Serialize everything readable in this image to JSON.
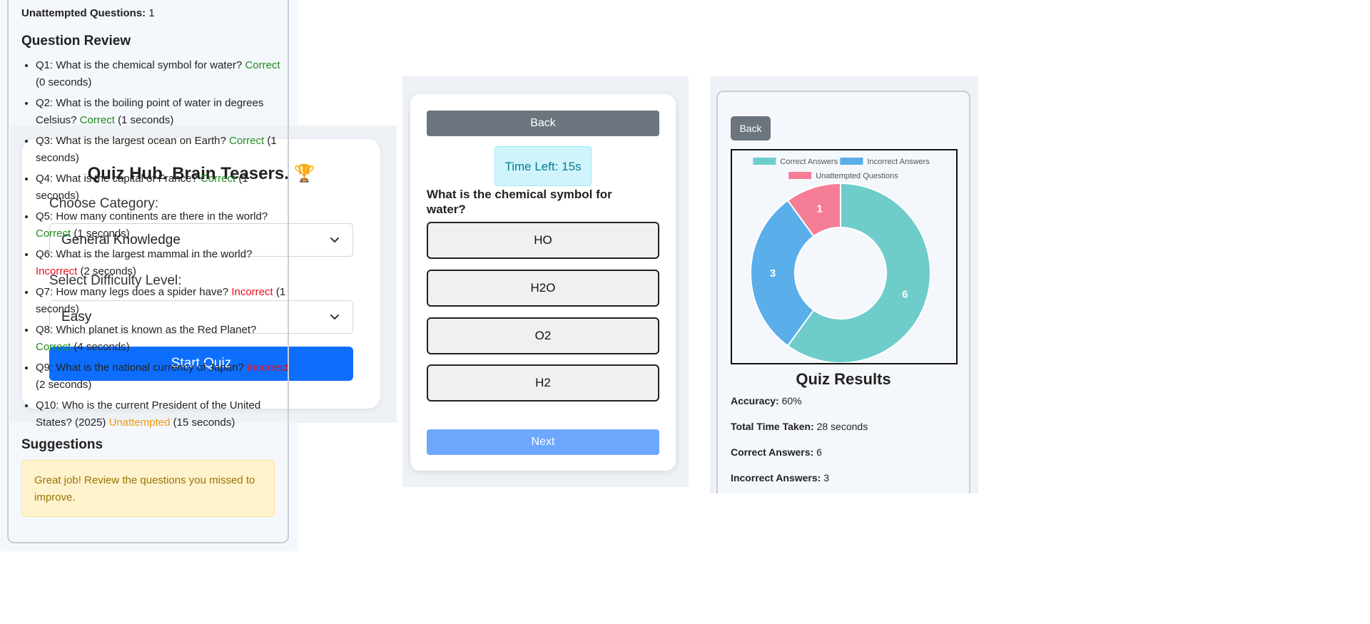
{
  "setup": {
    "title": "Quiz Hub. Brain Teasers.",
    "title_icon": "🏆",
    "category_label": "Choose Category:",
    "category_value": "General Knowledge",
    "difficulty_label": "Select Difficulty Level:",
    "difficulty_value": "Easy",
    "start_label": "Start Quiz"
  },
  "question": {
    "back_label": "Back",
    "timer_text": "Time Left: 15s",
    "text": "What is the chemical symbol for water?",
    "options": [
      "HO",
      "H2O",
      "O2",
      "H2"
    ],
    "next_label": "Next"
  },
  "results": {
    "back_label": "Back",
    "title": "Quiz Results",
    "stats": [
      {
        "label": "Accuracy:",
        "value": "60%"
      },
      {
        "label": "Total Time Taken:",
        "value": "28 seconds"
      },
      {
        "label": "Correct Answers:",
        "value": "6"
      },
      {
        "label": "Incorrect Answers:",
        "value": "3"
      }
    ]
  },
  "chart_data": {
    "type": "pie",
    "variant": "doughnut",
    "categories": [
      "Correct Answers",
      "Incorrect Answers",
      "Unattempted Questions"
    ],
    "values": [
      6,
      3,
      1
    ],
    "colors": [
      "#6ecdca",
      "#5aaeea",
      "#f57d96"
    ],
    "legend": "top"
  },
  "review": {
    "unattempted_label": "Unattempted Questions:",
    "unattempted_value": "1",
    "title": "Question Review",
    "items": [
      {
        "text": "Q1: What is the chemical symbol for water?",
        "status": "Correct",
        "time": "(0 seconds)",
        "kind": "correct"
      },
      {
        "text": "Q2: What is the boiling point of water in degrees Celsius?",
        "status": "Correct",
        "time": "(1 seconds)",
        "kind": "correct"
      },
      {
        "text": "Q3: What is the largest ocean on Earth?",
        "status": "Correct",
        "time": "(1 seconds)",
        "kind": "correct"
      },
      {
        "text": "Q4: What is the capital of France?",
        "status": "Correct",
        "time": "(1 seconds)",
        "kind": "correct"
      },
      {
        "text": "Q5: How many continents are there in the world?",
        "status": "Correct",
        "time": "(1 seconds)",
        "kind": "correct"
      },
      {
        "text": "Q6: What is the largest mammal in the world?",
        "status": "Incorrect",
        "time": "(2 seconds)",
        "kind": "incorrect"
      },
      {
        "text": "Q7: How many legs does a spider have?",
        "status": "Incorrect",
        "time": "(1 seconds)",
        "kind": "incorrect"
      },
      {
        "text": "Q8: Which planet is known as the Red Planet?",
        "status": "Correct",
        "time": "(4 seconds)",
        "kind": "correct"
      },
      {
        "text": "Q9: What is the national currency of Japan?",
        "status": "Incorrect",
        "time": "(2 seconds)",
        "kind": "incorrect"
      },
      {
        "text": "Q10: Who is the current President of the United States? (2025)",
        "status": "Unattempted",
        "time": "(15 seconds)",
        "kind": "unatt"
      }
    ],
    "suggestions_title": "Suggestions",
    "suggestion_text": "Great job! Review the questions you missed to improve."
  }
}
